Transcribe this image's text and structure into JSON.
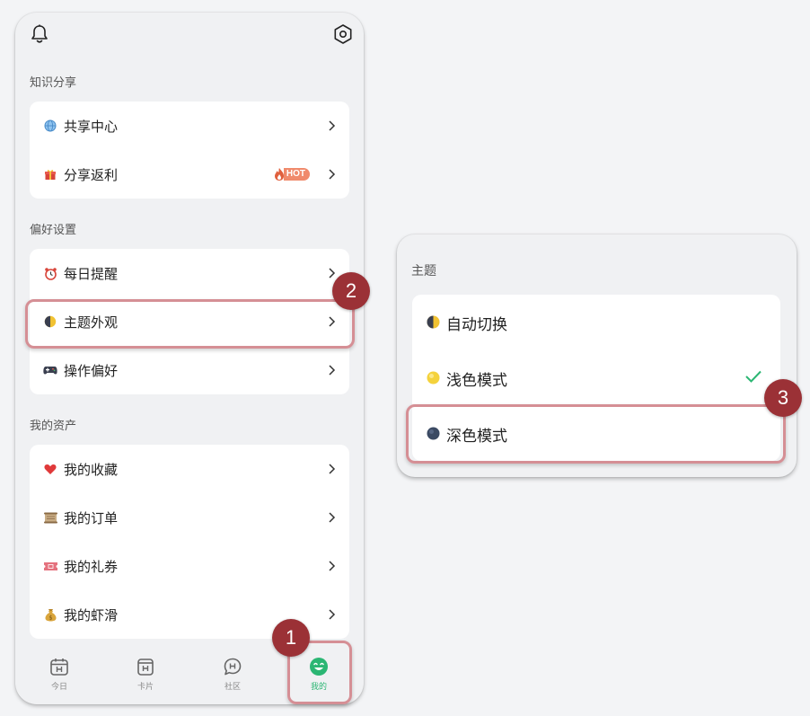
{
  "sections": {
    "knowledge": {
      "title": "知识分享",
      "items": [
        {
          "label": "共享中心",
          "icon": "globe-icon"
        },
        {
          "label": "分享返利",
          "icon": "gift-icon",
          "badge": "HOT"
        }
      ]
    },
    "preferences": {
      "title": "偏好设置",
      "items": [
        {
          "label": "每日提醒",
          "icon": "alarm-clock-icon"
        },
        {
          "label": "主题外观",
          "icon": "half-moon-icon"
        },
        {
          "label": "操作偏好",
          "icon": "gamepad-icon"
        }
      ]
    },
    "assets": {
      "title": "我的资产",
      "items": [
        {
          "label": "我的收藏",
          "icon": "heart-icon"
        },
        {
          "label": "我的订单",
          "icon": "scroll-icon"
        },
        {
          "label": "我的礼券",
          "icon": "ticket-icon"
        },
        {
          "label": "我的虾滑",
          "icon": "money-bag-icon"
        }
      ]
    }
  },
  "tabbar": {
    "tabs": [
      {
        "label": "今日",
        "icon": "calendar-icon"
      },
      {
        "label": "卡片",
        "icon": "card-icon"
      },
      {
        "label": "社区",
        "icon": "chat-icon"
      },
      {
        "label": "我的",
        "icon": "smile-icon",
        "active": true
      }
    ]
  },
  "theme_panel": {
    "title": "主题",
    "options": [
      {
        "label": "自动切换",
        "color": "#f1c232"
      },
      {
        "label": "浅色模式",
        "color": "#f4d23c",
        "selected": true
      },
      {
        "label": "深色模式",
        "color": "#3b4a63"
      }
    ]
  },
  "steps": [
    "1",
    "2",
    "3"
  ],
  "colors": {
    "accent": "#2bb673",
    "highlight": "#d58f95",
    "step": "#9b3136",
    "hot": "#f08a6c"
  }
}
